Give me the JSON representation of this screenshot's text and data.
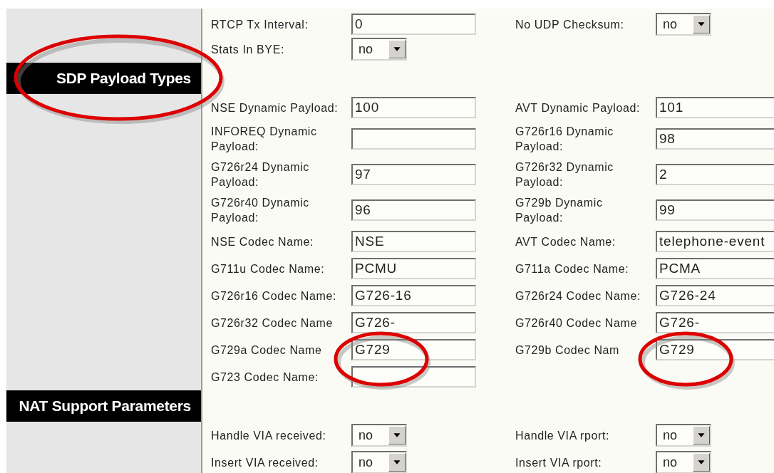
{
  "top_rows": [
    {
      "fields": [
        {
          "label": "RTCP Tx Interval:",
          "kind": "text",
          "value": "0"
        },
        {
          "label": "No UDP Checksum:",
          "kind": "select",
          "value": "no"
        }
      ]
    },
    {
      "fields": [
        {
          "label": "Stats In BYE:",
          "kind": "select",
          "value": "no"
        }
      ]
    }
  ],
  "sections": [
    {
      "title": "SDP Payload Types",
      "highlighted": true,
      "rows": [
        {
          "fields": [
            {
              "label": "NSE Dynamic Payload:",
              "kind": "text",
              "value": "100"
            },
            {
              "label": "AVT Dynamic Payload:",
              "kind": "text",
              "value": "101"
            }
          ]
        },
        {
          "fields": [
            {
              "label": "INFOREQ Dynamic Payload:",
              "kind": "text"
            },
            {
              "label": "G726r16 Dynamic Payload:",
              "kind": "text",
              "value": "98"
            }
          ]
        },
        {
          "fields": [
            {
              "label": "G726r24 Dynamic Payload:",
              "kind": "text",
              "value": "97"
            },
            {
              "label": "G726r32 Dynamic Payload:",
              "kind": "text",
              "value": "2"
            }
          ]
        },
        {
          "fields": [
            {
              "label": "G726r40 Dynamic Payload:",
              "kind": "text",
              "value": "96"
            },
            {
              "label": "G729b Dynamic Payload:",
              "kind": "text",
              "value": "99"
            }
          ]
        },
        {
          "fields": [
            {
              "label": "NSE Codec Name:",
              "kind": "text",
              "value": "NSE"
            },
            {
              "label": "AVT Codec Name:",
              "kind": "text",
              "value": "telephone-event"
            }
          ]
        },
        {
          "fields": [
            {
              "label": "G711u Codec Name:",
              "kind": "text",
              "value": "PCMU"
            },
            {
              "label": "G711a Codec Name:",
              "kind": "text",
              "value": "PCMA"
            }
          ]
        },
        {
          "fields": [
            {
              "label": "G726r16 Codec Name:",
              "kind": "text",
              "value": "G726-16"
            },
            {
              "label": "G726r24 Codec Name:",
              "kind": "text",
              "value": "G726-24"
            }
          ]
        },
        {
          "fields": [
            {
              "label": "G726r32 Codec Name",
              "kind": "text",
              "value": "G726-"
            },
            {
              "label": "G726r40 Codec Name",
              "kind": "text",
              "value": "G726-"
            }
          ]
        },
        {
          "fields": [
            {
              "label": "G729a Codec Name",
              "kind": "text",
              "value": "G729",
              "highlighted": true
            },
            {
              "label": "G729b Codec Nam",
              "kind": "text",
              "value": "G729",
              "highlighted": true
            }
          ]
        },
        {
          "fields": [
            {
              "label": "G723 Codec Name:",
              "kind": "text"
            }
          ]
        }
      ]
    },
    {
      "title": "NAT Support Parameters",
      "highlighted": false,
      "rows": [
        {
          "fields": [
            {
              "label": "Handle VIA received:",
              "kind": "select",
              "value": "no"
            },
            {
              "label": "Handle VIA rport:",
              "kind": "select",
              "value": "no"
            }
          ]
        },
        {
          "fields": [
            {
              "label": "Insert VIA received:",
              "kind": "select",
              "value": "no"
            },
            {
              "label": "Insert VIA rport:",
              "kind": "select",
              "value": "no"
            }
          ]
        }
      ]
    }
  ]
}
